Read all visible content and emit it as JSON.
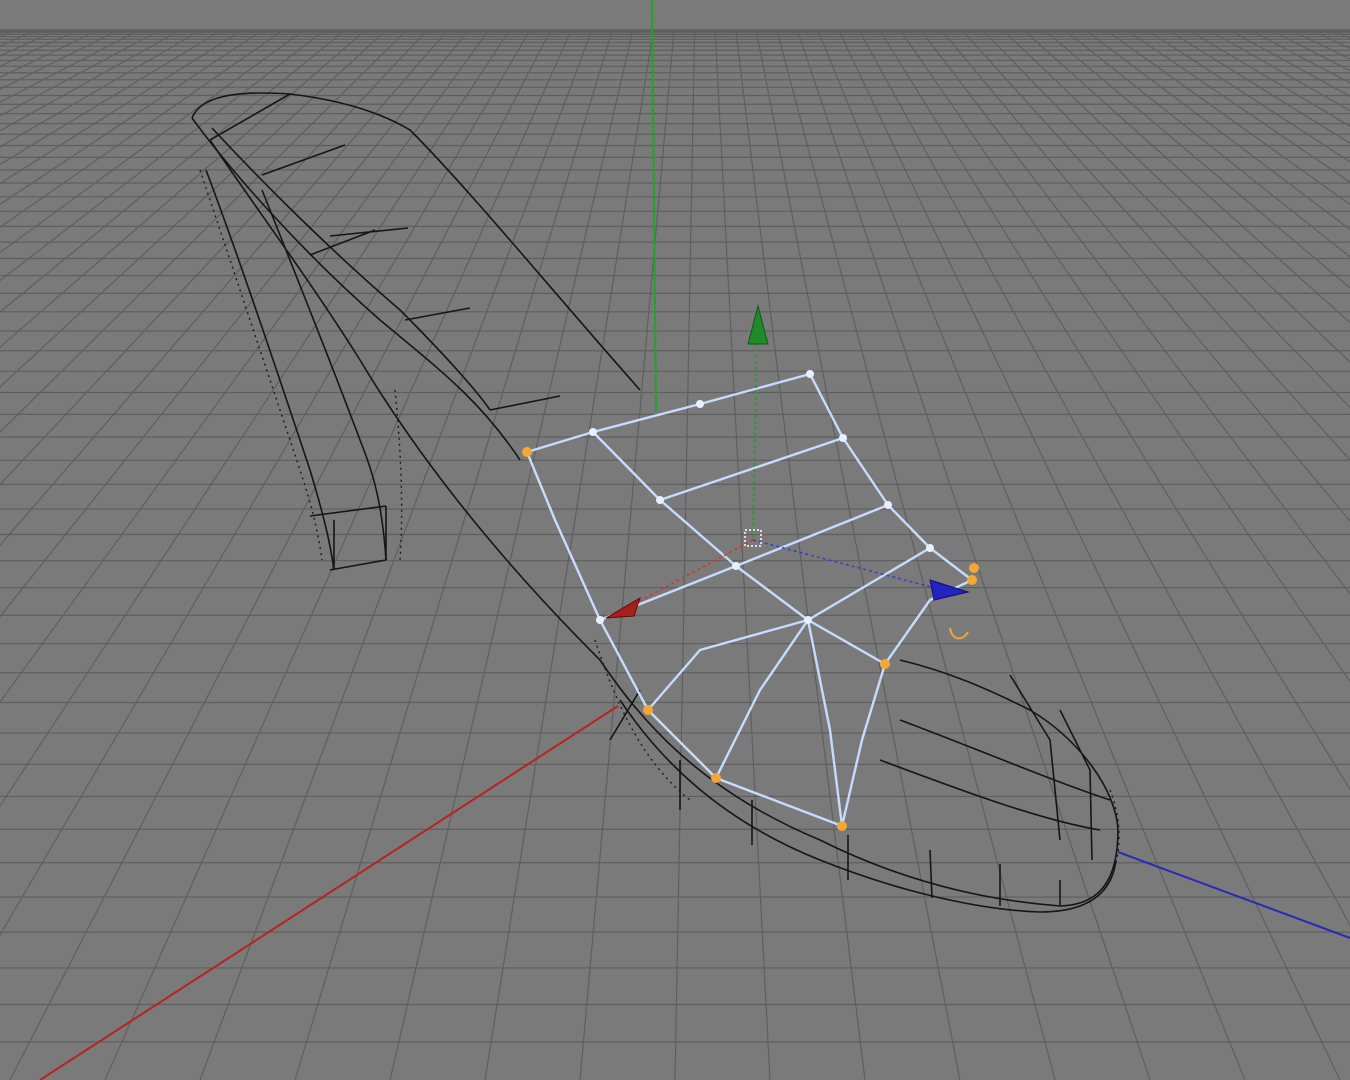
{
  "viewport": {
    "type": "perspective",
    "background": "#7a7a7a",
    "grid": "on",
    "grid_color": "#5f5f5f",
    "object": "high-heel-shoe",
    "display_mode": "wireframe",
    "selection": "toe-strap-mesh",
    "selection_color": "#c6dcff",
    "selected_point_color": "#f3a836"
  },
  "axes": {
    "x_color": "#b5251e",
    "y_color": "#23a32a",
    "z_color": "#2a2ab8"
  },
  "gizmo": {
    "tool": "move",
    "icons": [
      "move-x-arrow-icon",
      "move-y-arrow-icon",
      "move-z-arrow-icon"
    ]
  }
}
